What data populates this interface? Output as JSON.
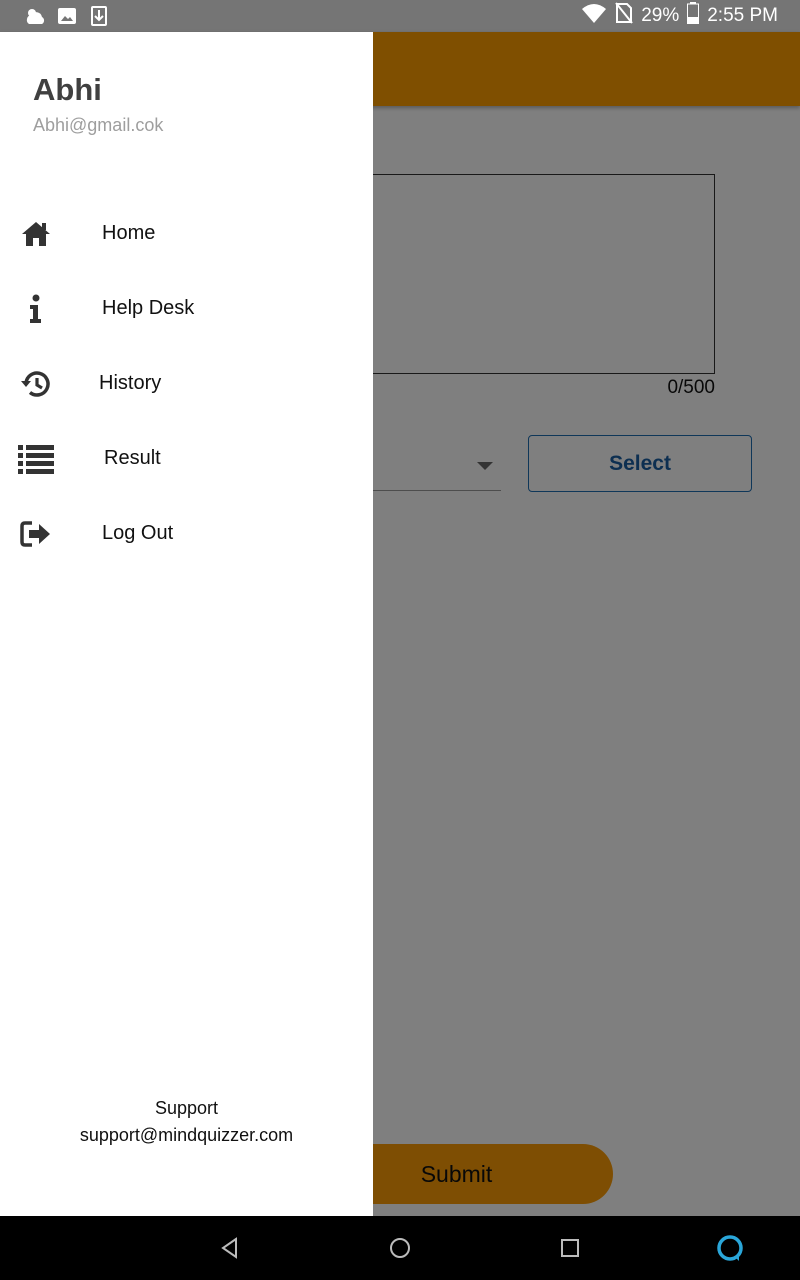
{
  "status_bar": {
    "battery": "29%",
    "time": "2:55 PM",
    "icons": [
      "weather-icon",
      "image-notification-icon",
      "download-icon",
      "wifi-icon",
      "no-sim-icon",
      "battery-icon"
    ]
  },
  "background_screen": {
    "question_fragment": "?",
    "answer_counter": "0/500",
    "select_label": "Select",
    "submit_label": "Submit",
    "accent_color": "#fe9f00"
  },
  "drawer": {
    "user": {
      "name": "Abhi",
      "email": "Abhi@gmail.cok"
    },
    "items": [
      {
        "label": "Home",
        "icon": "home-icon"
      },
      {
        "label": "Help Desk",
        "icon": "info-icon"
      },
      {
        "label": "History",
        "icon": "history-icon"
      },
      {
        "label": "Result",
        "icon": "list-icon"
      },
      {
        "label": "Log Out",
        "icon": "logout-icon"
      }
    ],
    "support": {
      "title": "Support",
      "email": "support@mindquizzer.com"
    }
  },
  "nav_bar": {
    "buttons": [
      "back-icon",
      "home-circle-icon",
      "recents-icon",
      "assistant-icon"
    ]
  }
}
